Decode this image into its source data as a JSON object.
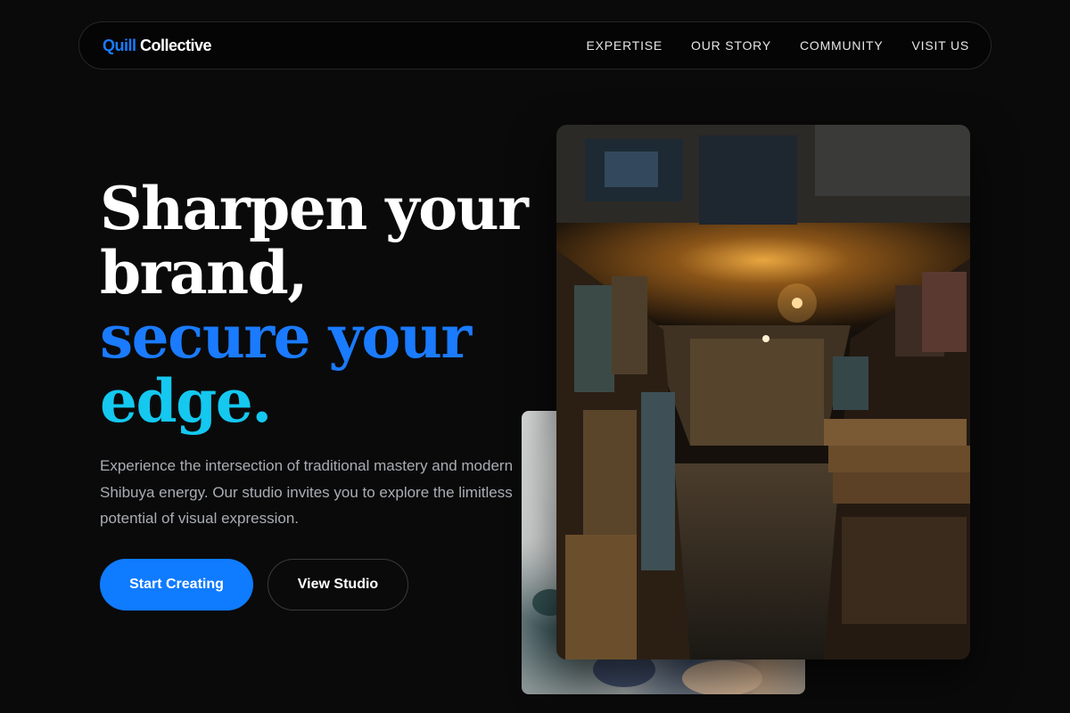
{
  "brand": {
    "accent": "Quill",
    "rest": " Collective",
    "accent_color": "#1a7bff"
  },
  "nav": {
    "links": [
      "EXPERTISE",
      "OUR STORY",
      "COMMUNITY",
      "VISIT US"
    ]
  },
  "hero": {
    "line1": "Sharpen your",
    "line2": "brand,",
    "line3": "secure your",
    "line4": "edge.",
    "subtext": "Experience the intersection of traditional mastery and modern Shibuya energy. Our studio invites you to explore the limitless potential of visual expression.",
    "primary_cta": "Start Creating",
    "secondary_cta": "View Studio"
  },
  "colors": {
    "background": "#0a0a0a",
    "primary_button": "#0f7bff",
    "headline_blue": "#1a7bff",
    "headline_cyan": "#14c8f0"
  },
  "images": {
    "front": "art-studio-corridor-photo",
    "back": "paint-texture-photo"
  }
}
